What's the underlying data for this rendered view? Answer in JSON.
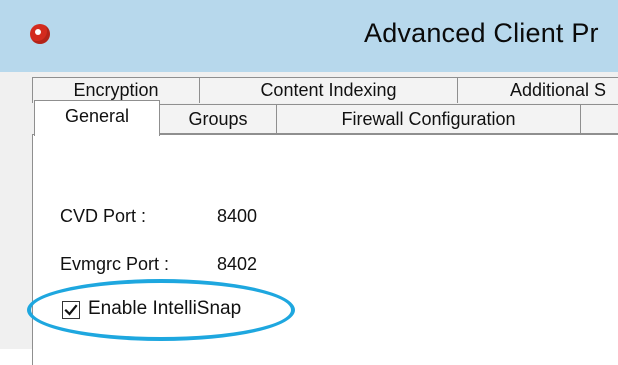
{
  "window": {
    "title": "Advanced Client Pr",
    "icon": "app-logo-icon"
  },
  "tabs": {
    "back_row": [
      "Encryption",
      "Content Indexing",
      "Additional S"
    ],
    "front_row": [
      "General",
      "Groups",
      "Firewall Configuration"
    ],
    "active": "General"
  },
  "panel": {
    "cvd_port_label": "CVD Port :",
    "cvd_port_value": "8400",
    "evmgrc_port_label": "Evmgrc Port :",
    "evmgrc_port_value": "8402",
    "intellisnap_label": "Enable IntelliSnap",
    "intellisnap_checked": true
  },
  "colors": {
    "titlebar": "#b7d8ec",
    "highlight": "#1ea7df",
    "app_icon": "#d32b1e"
  }
}
